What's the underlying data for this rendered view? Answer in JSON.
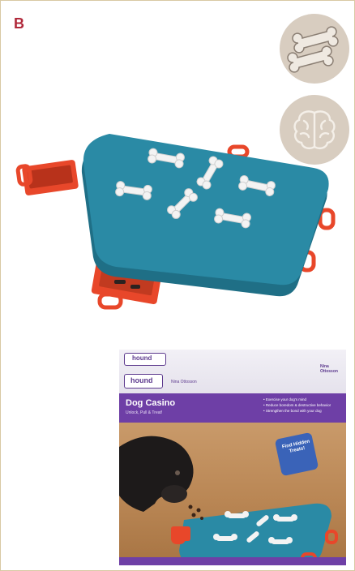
{
  "panel": {
    "letter": "B"
  },
  "badges": [
    {
      "icon": "bone-treats-icon"
    },
    {
      "icon": "brain-icon"
    }
  ],
  "box": {
    "brand": "hound",
    "partner": "Nina Ottosson",
    "corner_brand": "Nina Ottosson",
    "title": "Dog Casino",
    "subtitle": "Unlock, Pull & Treat!",
    "bullets": [
      "• Exercise your dog's mind",
      "• Reduce boredom & destructive behavior",
      "• Strengthen the bond with your dog"
    ],
    "puzzle_text": "Find Hidden Treats!"
  },
  "colors": {
    "panel_letter": "#b0283a",
    "badge": "#d8cdc0",
    "toy_blue": "#2a8aa5",
    "drawer_orange": "#e8472a",
    "box_purple": "#6e3fa6"
  }
}
